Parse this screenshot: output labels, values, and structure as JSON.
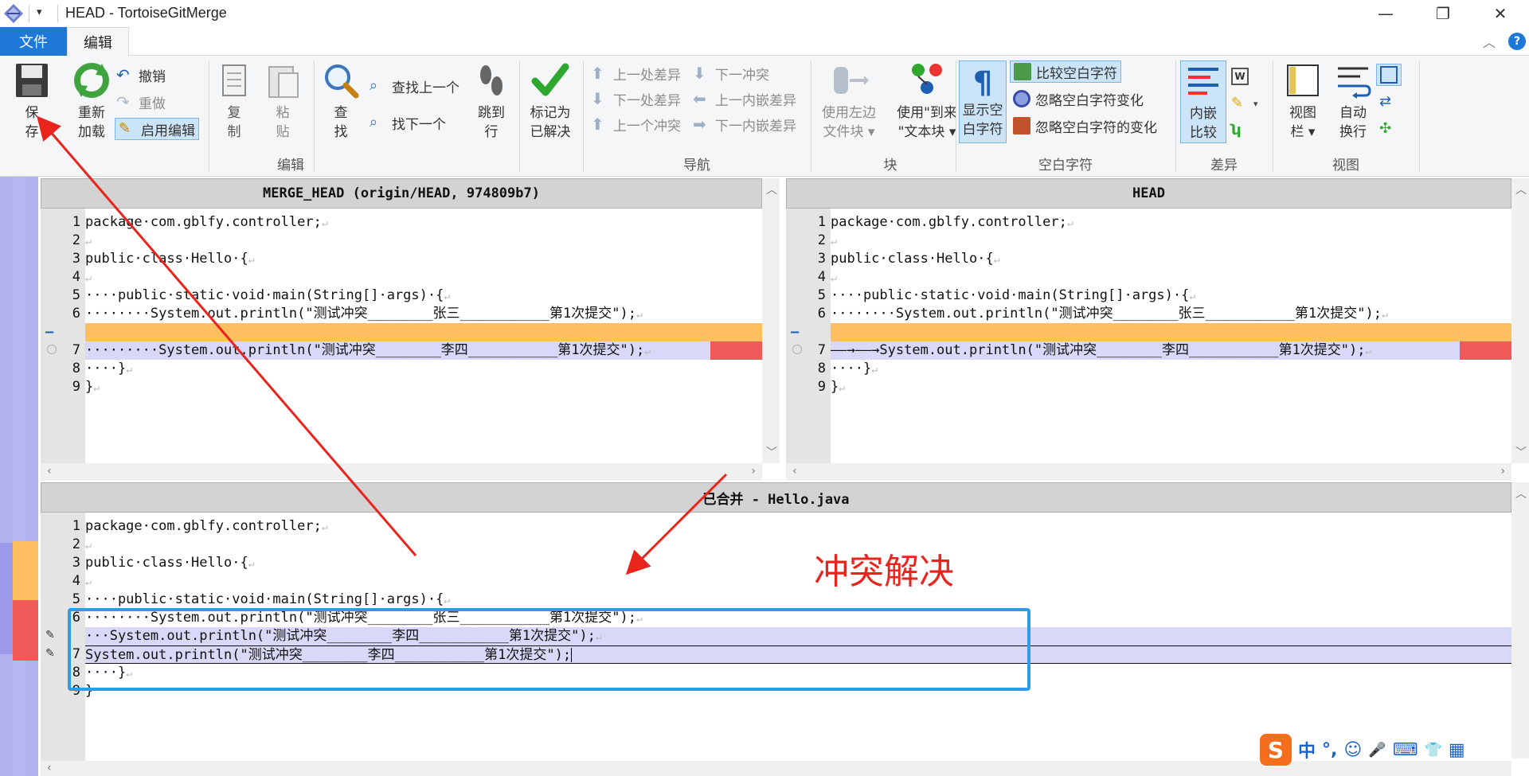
{
  "window": {
    "title": "HEAD - TortoiseGitMerge",
    "quick_access": "▾",
    "minimize": "—",
    "maximize": "❐",
    "close": "✕"
  },
  "tabs": [
    {
      "label": "文件"
    },
    {
      "label": "编辑"
    }
  ],
  "ribbon": {
    "collapse": "︿",
    "help": "?",
    "groups": {
      "edit": {
        "label": "编辑",
        "save": "保\n存",
        "reload": "重新\n加载",
        "undo": "撤销",
        "redo": "重做",
        "enable_edit": "启用编辑",
        "copy": "复\n制",
        "paste": "粘\n贴",
        "find": "查\n找",
        "find_prev": "查找上一个",
        "find_next": "找下一个",
        "goto_line": "跳到\n行",
        "mark_resolved": "标记为\n已解决"
      },
      "nav": {
        "label": "导航",
        "prev_diff": "上一处差异",
        "next_diff": "下一处差异",
        "prev_conflict": "上一个冲突",
        "next_conflict": "下一冲突",
        "prev_inline": "上一内嵌差异",
        "next_inline": "下一内嵌差异"
      },
      "block": {
        "label": "块",
        "use_left": "使用左边\n文件块 ▾",
        "use_to": "使用\"到来\n\"文本块 ▾"
      },
      "whitespace": {
        "label": "空白字符",
        "show_ws": "显示空\n白字符",
        "compare_ws": "比较空白字符",
        "ignore_ws_change": "忽略空白字符变化",
        "ignore_all_ws": "忽略空白字符的变化"
      },
      "diff": {
        "label": "差异",
        "inline": "内嵌\n比较"
      },
      "view": {
        "label": "视图",
        "viewbar": "视图\n栏 ▾",
        "wrap": "自动\n换行"
      }
    }
  },
  "panes": {
    "left": {
      "header": "MERGE_HEAD (origin/HEAD, 974809b7)",
      "lines": [
        {
          "no": "1",
          "text": "package·com.gblfy.controller;",
          "ret": "↵"
        },
        {
          "no": "2",
          "text": "",
          "ret": "↵"
        },
        {
          "no": "3",
          "text": "public·class·Hello·{",
          "ret": "↵"
        },
        {
          "no": "4",
          "text": "",
          "ret": "↵"
        },
        {
          "no": "5",
          "text": "····public·static·void·main(String[]·args)·{",
          "ret": "↵"
        },
        {
          "no": "6",
          "text": "········System.out.println(\"测试冲突________张三___________第1次提交\");",
          "ret": "↵"
        },
        {
          "no": "–",
          "text": "",
          "ret": ""
        },
        {
          "no": "7",
          "text": "·········System.out.println(\"测试冲突________李四___________第1次提交\");",
          "ret": "↵"
        },
        {
          "no": "8",
          "text": "····}",
          "ret": "↵"
        },
        {
          "no": "9",
          "text": "}",
          "ret": "↵"
        }
      ]
    },
    "right": {
      "header": "HEAD",
      "lines": [
        {
          "no": "1",
          "text": "package·com.gblfy.controller;",
          "ret": "↵"
        },
        {
          "no": "2",
          "text": "",
          "ret": "↵"
        },
        {
          "no": "3",
          "text": "public·class·Hello·{",
          "ret": "↵"
        },
        {
          "no": "4",
          "text": "",
          "ret": "↵"
        },
        {
          "no": "5",
          "text": "····public·static·void·main(String[]·args)·{",
          "ret": "↵"
        },
        {
          "no": "6",
          "text": "········System.out.println(\"测试冲突________张三___________第1次提交\");",
          "ret": "↵"
        },
        {
          "no": "–",
          "text": "",
          "ret": ""
        },
        {
          "no": "7",
          "text": "——→——→System.out.println(\"测试冲突________李四___________第1次提交\");",
          "ret": "↵"
        },
        {
          "no": "8",
          "text": "····}",
          "ret": "↵"
        },
        {
          "no": "9",
          "text": "}",
          "ret": "↵"
        }
      ]
    },
    "bottom": {
      "header": "已合并 - Hello.java",
      "lines": [
        {
          "no": "1",
          "text": "package·com.gblfy.controller;",
          "ret": "↵"
        },
        {
          "no": "2",
          "text": "",
          "ret": "↵"
        },
        {
          "no": "3",
          "text": "public·class·Hello·{",
          "ret": "↵"
        },
        {
          "no": "4",
          "text": "",
          "ret": "↵"
        },
        {
          "no": "5",
          "text": "····public·static·void·main(String[]·args)·{",
          "ret": "↵"
        },
        {
          "no": "6",
          "text": "········System.out.println(\"测试冲突________张三___________第1次提交\");",
          "ret": "↵"
        },
        {
          "no": "",
          "text": "···System.out.println(\"测试冲突________李四___________第1次提交\");",
          "ret": "↵"
        },
        {
          "no": "7",
          "text": "System.out.println(\"测试冲突________李四___________第1次提交\");",
          "ret": ""
        },
        {
          "no": "8",
          "text": "····}",
          "ret": "↵"
        },
        {
          "no": "9",
          "text": "}",
          "ret": ""
        }
      ]
    }
  },
  "annotation": {
    "text": "冲突解决"
  },
  "ime": {
    "lang": "中",
    "punct": "°,",
    "emoji": "☺",
    "voice": "🎤",
    "keyboard": "⌨",
    "skin": "👕",
    "menu": "▦"
  },
  "colors": {
    "ribbon_blue": "#1e78d7",
    "conflict_orange": "#fdbf5f",
    "conflict_purple": "#d8d8f8",
    "conflict_red": "#f25a5a",
    "annotation_red": "#e8241c",
    "annotation_blue": "#2d9be6"
  }
}
